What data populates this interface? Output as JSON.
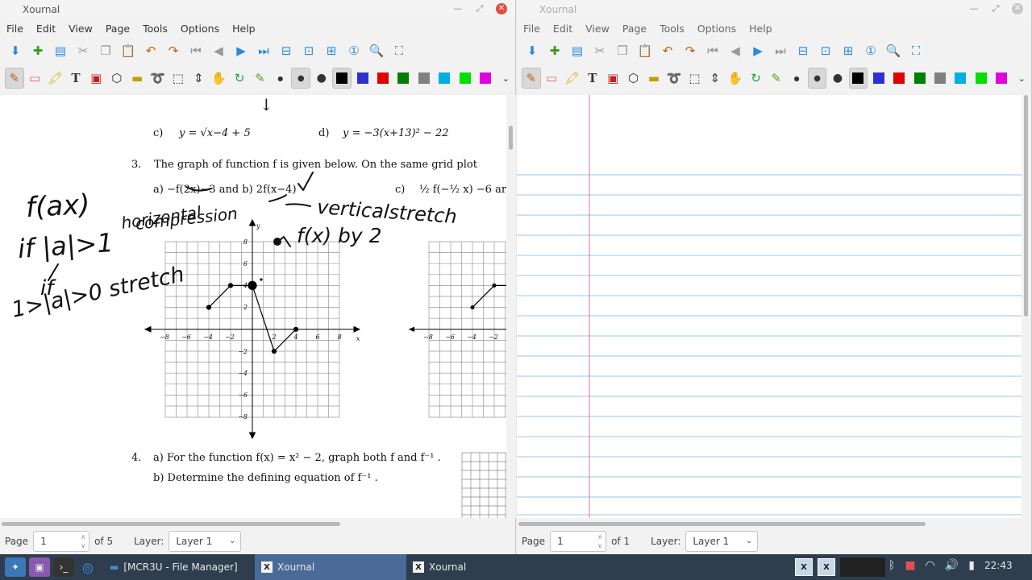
{
  "windows": {
    "left": {
      "title": "Xournal",
      "menu": [
        "File",
        "Edit",
        "View",
        "Page",
        "Tools",
        "Options",
        "Help"
      ],
      "status": {
        "page_label": "Page",
        "page_value": "1",
        "of_pages": "of 5",
        "layer_label": "Layer:",
        "layer_value": "Layer 1"
      }
    },
    "right": {
      "title": "Xournal",
      "menu": [
        "File",
        "Edit",
        "View",
        "Page",
        "Tools",
        "Options",
        "Help"
      ],
      "status": {
        "page_label": "Page",
        "page_value": "1",
        "of_pages": "of 1",
        "layer_label": "Layer:",
        "layer_value": "Layer 1"
      }
    }
  },
  "pen_colors": [
    "#000000",
    "#3030d0",
    "#e00000",
    "#008000",
    "#808080",
    "#00b0e0",
    "#00e000",
    "#e000e0"
  ],
  "document": {
    "q_c_label": "c)",
    "q_c_expr": "y = √x−4 + 5",
    "q_d_label": "d)",
    "q_d_expr": "y = −3(x+13)² − 22",
    "q3_num": "3.",
    "q3_text": "The graph of function f is given below.  On the same grid plot",
    "q3a": "a)    −f(2x)−3  and b)  2f(x−4)",
    "q3c": "c)",
    "q3c_expr": "½ f(−½ x) −6  ar",
    "q4_num": "4.",
    "q4a": "a)    For the function  f(x) = x² − 2, graph both f and  f⁻¹ .",
    "q4b": "b)    Determine the defining equation of  f⁻¹ .",
    "graph_ticks_x": [
      "−8",
      "−6",
      "−4",
      "−2",
      "2",
      "4",
      "6",
      "8"
    ],
    "graph_ticks_y": [
      "8",
      "6",
      "4",
      "2",
      "−2",
      "−4",
      "−6",
      "−8"
    ],
    "x_axis_label": "x",
    "y_axis_label": "y",
    "handwriting": {
      "fax": "f(ax)",
      "if_abs": "if |a|>1",
      "horizontal": "horizontal",
      "compression": "compression",
      "if2": "if",
      "stretch_cond": "1>|a|>0  stretch",
      "vertical": "verticalstretch",
      "fx_by2": "f(x)  by 2"
    }
  },
  "taskbar": {
    "tasks": [
      "[MCR3U - File Manager]",
      "Xournal",
      "Xournal"
    ],
    "clock": "22:43"
  }
}
